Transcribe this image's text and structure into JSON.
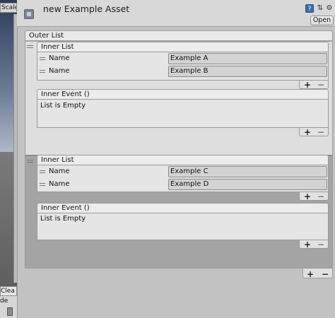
{
  "scene": {
    "scale_label": "Scale",
    "clear_label": "Clea",
    "console_glyph": "de"
  },
  "header": {
    "title": "new Example Asset",
    "open_label": "Open",
    "icons": {
      "asset": "scriptable-asset-icon",
      "help": "help-icon",
      "preset": "preset-icon",
      "settings": "gear-icon"
    },
    "help_glyph": "?",
    "preset_glyph": "⇅",
    "gear_glyph": "⚙"
  },
  "outer_list": {
    "label": "Outer List",
    "add_glyph": "+",
    "remove_glyph": "−",
    "elements": [
      {
        "inner_list": {
          "label": "Inner List",
          "add_glyph": "+",
          "remove_glyph": "−",
          "items": [
            {
              "label": "Name",
              "value": "Example A"
            },
            {
              "label": "Name",
              "value": "Example B"
            }
          ]
        },
        "inner_event": {
          "label": "Inner Event ()",
          "empty_text": "List is Empty",
          "add_glyph": "+",
          "remove_glyph": "−"
        }
      },
      {
        "inner_list": {
          "label": "Inner List",
          "add_glyph": "+",
          "remove_glyph": "−",
          "items": [
            {
              "label": "Name",
              "value": "Example C"
            },
            {
              "label": "Name",
              "value": "Example D"
            }
          ]
        },
        "inner_event": {
          "label": "Inner Event ()",
          "empty_text": "List is Empty",
          "add_glyph": "+",
          "remove_glyph": "−"
        }
      }
    ]
  },
  "colors": {
    "help_accent": "#3f6ea6",
    "selected_element_bg": "#a4a4a4",
    "inspector_bg": "#c2c2c2"
  }
}
